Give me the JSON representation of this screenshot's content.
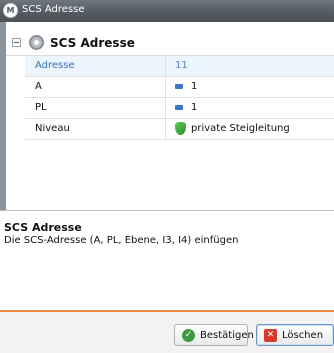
{
  "window": {
    "title": "SCS Adresse"
  },
  "grid": {
    "group_title": "SCS Adresse",
    "rows": [
      {
        "label": "Adresse",
        "value": "11",
        "icon": ""
      },
      {
        "label": "A",
        "value": "1",
        "icon": "number-icon"
      },
      {
        "label": "PL",
        "value": "1",
        "icon": "number-icon"
      },
      {
        "label": "Niveau",
        "value": "private Steigleitung",
        "icon": "shield-icon"
      }
    ]
  },
  "description": {
    "title": "SCS Adresse",
    "text": "Die SCS-Adresse (A, PL, Ebene, I3, I4) einfügen"
  },
  "buttons": {
    "confirm": "Bestätigen",
    "delete": "Löschen"
  },
  "colors": {
    "accent": "#f08a3c",
    "titlebar": "#555c63",
    "selection": "#ecf4fc"
  }
}
